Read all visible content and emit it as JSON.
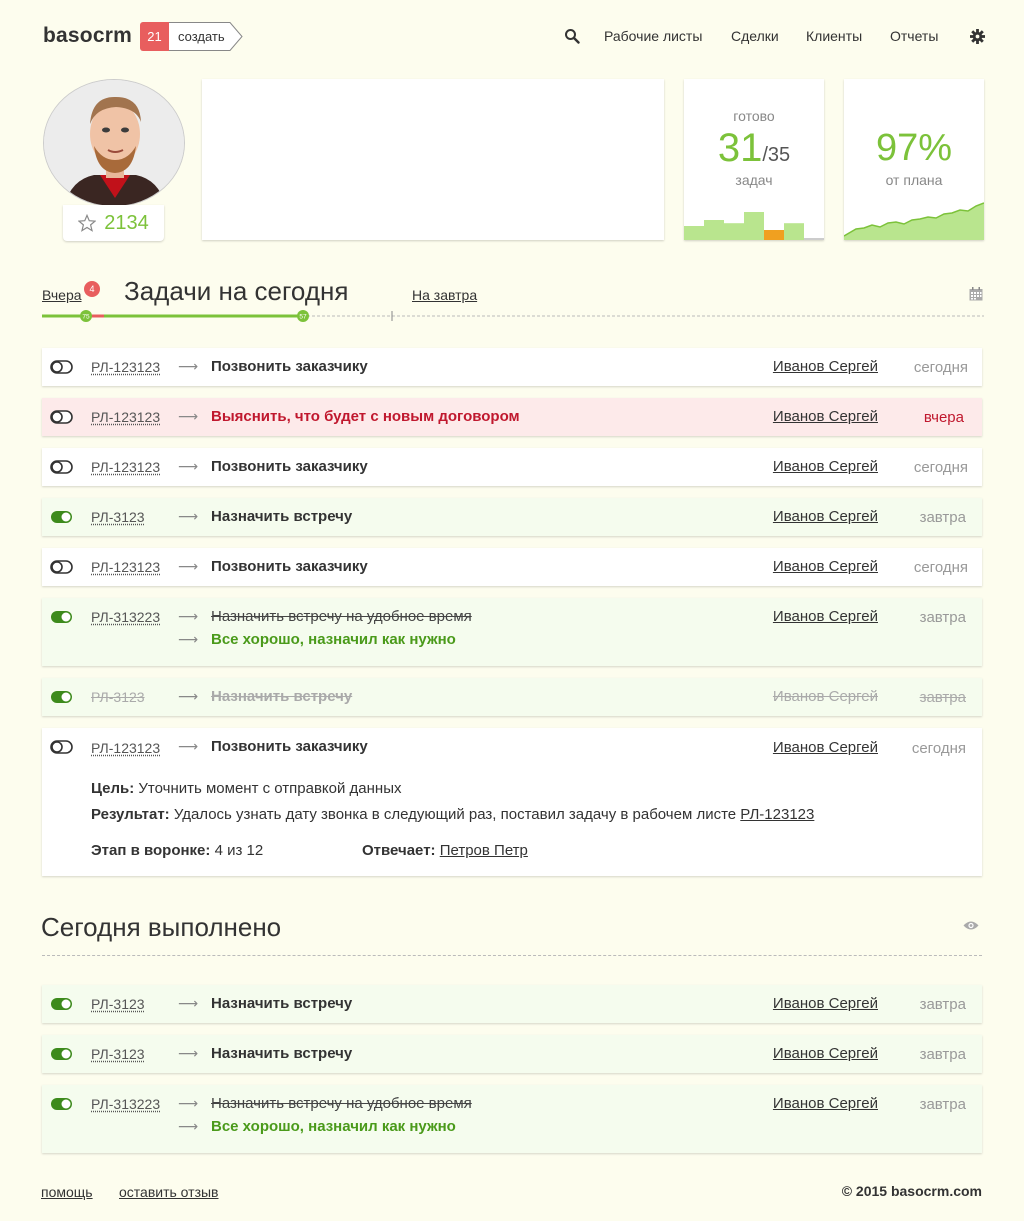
{
  "header": {
    "logo": "basocrm",
    "create_count": "21",
    "create_label": "создать",
    "nav": [
      "Рабочие листы",
      "Сделки",
      "Клиенты",
      "Отчеты"
    ]
  },
  "profile": {
    "score": "2134"
  },
  "stats": {
    "done_caption": "готово",
    "done_value": "31",
    "done_total": "/35",
    "done_unit": "задач",
    "done_bars": [
      0.35,
      0.5,
      0.42,
      0.7,
      0.25,
      0.42,
      0.05
    ],
    "done_bar_colors": [
      "#b9e58e",
      "#b9e58e",
      "#b9e58e",
      "#b9e58e",
      "#f0a020",
      "#b9e58e",
      "#cccccc"
    ],
    "plan_value": "97%",
    "plan_caption": "от плана",
    "accent": "#7cc23a"
  },
  "tabs": {
    "yesterday": "Вчера",
    "badge": "4",
    "today_title": "Задачи на сегодня",
    "tomorrow": "На завтра",
    "marker_start": "75",
    "marker_end": "57"
  },
  "tasks": [
    {
      "id": "РЛ-123123",
      "title": "Позвонить заказчику",
      "assignee": "Иванов Сергей",
      "when": "сегодня"
    },
    {
      "id": "РЛ-123123",
      "title": "Выяснить, что будет с новым договором",
      "assignee": "Иванов Сергей",
      "when": "вчера"
    },
    {
      "id": "РЛ-123123",
      "title": "Позвонить заказчику",
      "assignee": "Иванов Сергей",
      "when": "сегодня"
    },
    {
      "id": "РЛ-3123",
      "title": "Назначить встречу",
      "assignee": "Иванов Сергей",
      "when": "завтра"
    },
    {
      "id": "РЛ-123123",
      "title": "Позвонить заказчику",
      "assignee": "Иванов Сергей",
      "when": "сегодня"
    },
    {
      "id": "РЛ-313223",
      "title": "Назначить встречу на удобное время",
      "result": "Все хорошо, назначил как нужно",
      "assignee": "Иванов Сергей",
      "when": "завтра"
    },
    {
      "id": "РЛ-3123",
      "title": "Назначить встречу",
      "assignee": "Иванов Сергей",
      "when": "завтра"
    },
    {
      "id": "РЛ-123123",
      "title": "Позвонить заказчику",
      "assignee": "Иванов Сергей",
      "when": "сегодня",
      "goal_label": "Цель:",
      "goal": "Уточнить момент с отправкой данных",
      "result_label": "Результат:",
      "result_text": "Удалось узнать дату звонка в следующий раз, поставил задачу в рабочем листе",
      "result_link": "РЛ-123123",
      "stage_label": "Этап в воронке:",
      "stage": "4 из 12",
      "owner_label": "Отвечает:",
      "owner": "Петров Петр"
    }
  ],
  "completed": {
    "title": "Сегодня выполнено",
    "tasks": [
      {
        "id": "РЛ-3123",
        "title": "Назначить встречу",
        "assignee": "Иванов Сергей",
        "when": "завтра"
      },
      {
        "id": "РЛ-3123",
        "title": "Назначить встречу",
        "assignee": "Иванов Сергей",
        "when": "завтра"
      },
      {
        "id": "РЛ-313223",
        "title": "Назначить встречу на удобное время",
        "result": "Все хорошо, назначил как нужно",
        "assignee": "Иванов Сергей",
        "when": "завтра"
      }
    ]
  },
  "footer": {
    "help": "помощь",
    "feedback": "оставить отзыв",
    "copyright": "© 2015 basocrm.com"
  }
}
